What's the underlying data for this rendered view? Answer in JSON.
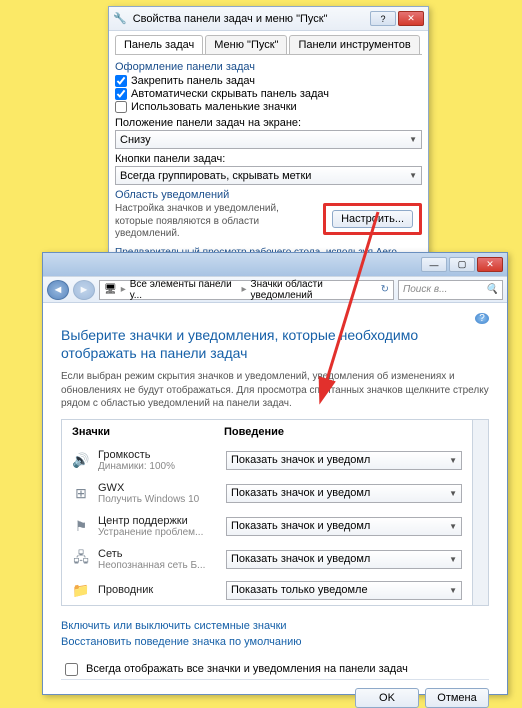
{
  "win1": {
    "title": "Свойства панели задач и меню \"Пуск\"",
    "tabs": [
      "Панель задач",
      "Меню \"Пуск\"",
      "Панели инструментов"
    ],
    "section_design": "Оформление панели задач",
    "cb_lock": "Закрепить панель задач",
    "cb_autohide": "Автоматически скрывать панель задач",
    "cb_small": "Использовать маленькие значки",
    "pos_label": "Положение панели задач на экране:",
    "pos_value": "Снизу",
    "btns_label": "Кнопки панели задач:",
    "btns_value": "Всегда группировать, скрывать метки",
    "notif_section": "Область уведомлений",
    "notif_text": "Настройка значков и уведомлений, которые появляются в области уведомлений.",
    "config_btn": "Настроить...",
    "aero": "Предварительный просмотр рабочего стола, используя Aero Peek"
  },
  "win2": {
    "breadcrumb_a": "Все элементы панели у...",
    "breadcrumb_b": "Значки области уведомлений",
    "search_placeholder": "Поиск в...",
    "heading": "Выберите значки и уведомления, которые необходимо отображать на панели задач",
    "desc": "Если выбран режим скрытия значков и уведомлений, уведомления об изменениях и обновлениях не будут отображаться. Для просмотра спрятанных значков щелкните стрелку рядом с областью уведомлений на панели задач.",
    "col_icons": "Значки",
    "col_behavior": "Поведение",
    "items": [
      {
        "name": "Громкость",
        "sub": "Динамики: 100%",
        "behavior": "Показать значок и уведомл"
      },
      {
        "name": "GWX",
        "sub": "Получить Windows 10",
        "behavior": "Показать значок и уведомл"
      },
      {
        "name": "Центр поддержки",
        "sub": "Устранение проблем...",
        "behavior": "Показать значок и уведомл"
      },
      {
        "name": "Сеть",
        "sub": "Неопознанная сеть Б...",
        "behavior": "Показать значок и уведомл"
      },
      {
        "name": "Проводник",
        "sub": "",
        "behavior": "Показать только уведомле"
      }
    ],
    "link1": "Включить или выключить системные значки",
    "link2": "Восстановить поведение значка по умолчанию",
    "always_cb": "Всегда отображать все значки и уведомления на панели задач",
    "ok": "OK",
    "cancel": "Отмена"
  }
}
